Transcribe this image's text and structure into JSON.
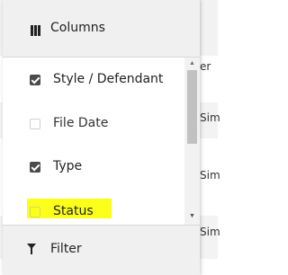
{
  "menu": {
    "header": {
      "label": "Columns",
      "icon": "columns-icon"
    },
    "items": [
      {
        "label": "Style / Defendant",
        "checked": true
      },
      {
        "label": "File Date",
        "checked": false
      },
      {
        "label": "Type",
        "checked": true
      },
      {
        "label": "Status",
        "checked": false,
        "highlighted": true
      }
    ],
    "footer": {
      "label": "Filter",
      "icon": "filter-icon"
    }
  },
  "background_table": {
    "cells": [
      "er",
      "Sim",
      "Sim",
      "Sim"
    ]
  },
  "colors": {
    "highlight": "#fbff1a",
    "header_bg": "#f0f0f0",
    "checkbox_checked": "#4b4b4b"
  }
}
